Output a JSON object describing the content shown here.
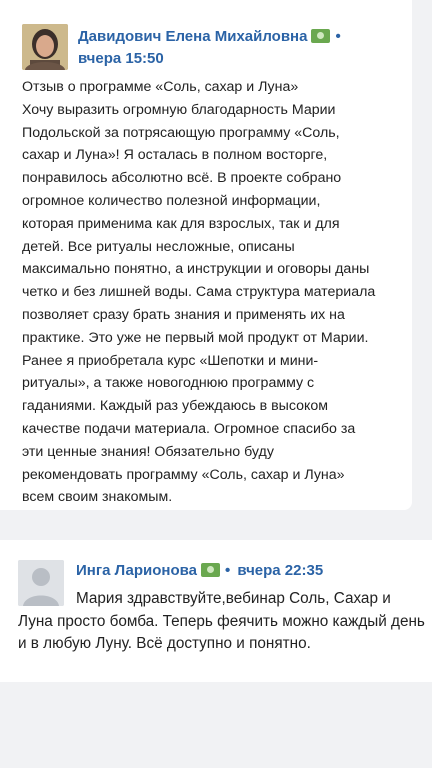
{
  "review1": {
    "author": "Давидович Елена Михайловна",
    "badge_icon": "money-icon",
    "time": "вчера 15:50",
    "text": "Отзыв о программе «Соль, сахар и Луна»\nХочу выразить огромную благодарность Марии\nПодольской за потрясающую программу «Соль,\nсахар и Луна»! Я осталась в полном восторге,\nпонравилось абсолютно всё. В проекте собрано\nогромное количество полезной информации,\nкоторая применима как для взрослых, так и для\nдетей. Все ритуалы несложные, описаны\nмаксимально понятно, а инструкции и оговоры даны\nчетко и без лишней воды. Сама структура материала\nпозволяет сразу брать знания и применять их на\nпрактике. Это уже не первый мой продукт от Марии.\nРанее я приобретала курс «Шепотки и мини-\nритуалы», а также новогоднюю программу с\nгаданиями. Каждый раз убеждаюсь в высоком\nкачестве подачи материала. Огромное спасибо за\nэти ценные знания! Обязательно буду\nрекомендовать программу «Соль, сахар и Луна»\nвсем своим знакомым."
  },
  "review2": {
    "author": "Инга Ларионова",
    "badge_icon": "money-icon",
    "time": "вчера 22:35",
    "text": "Мария здравствуйте,вебинар Соль, Сахар и Луна просто бомба. Теперь феячить можно каждый день и в любую Луну. Всё доступно и понятно."
  },
  "separator": "•",
  "colors": {
    "accent": "#2b63a6",
    "badge": "#6aa84f",
    "background": "#f1f2f4",
    "card": "#ffffff"
  }
}
